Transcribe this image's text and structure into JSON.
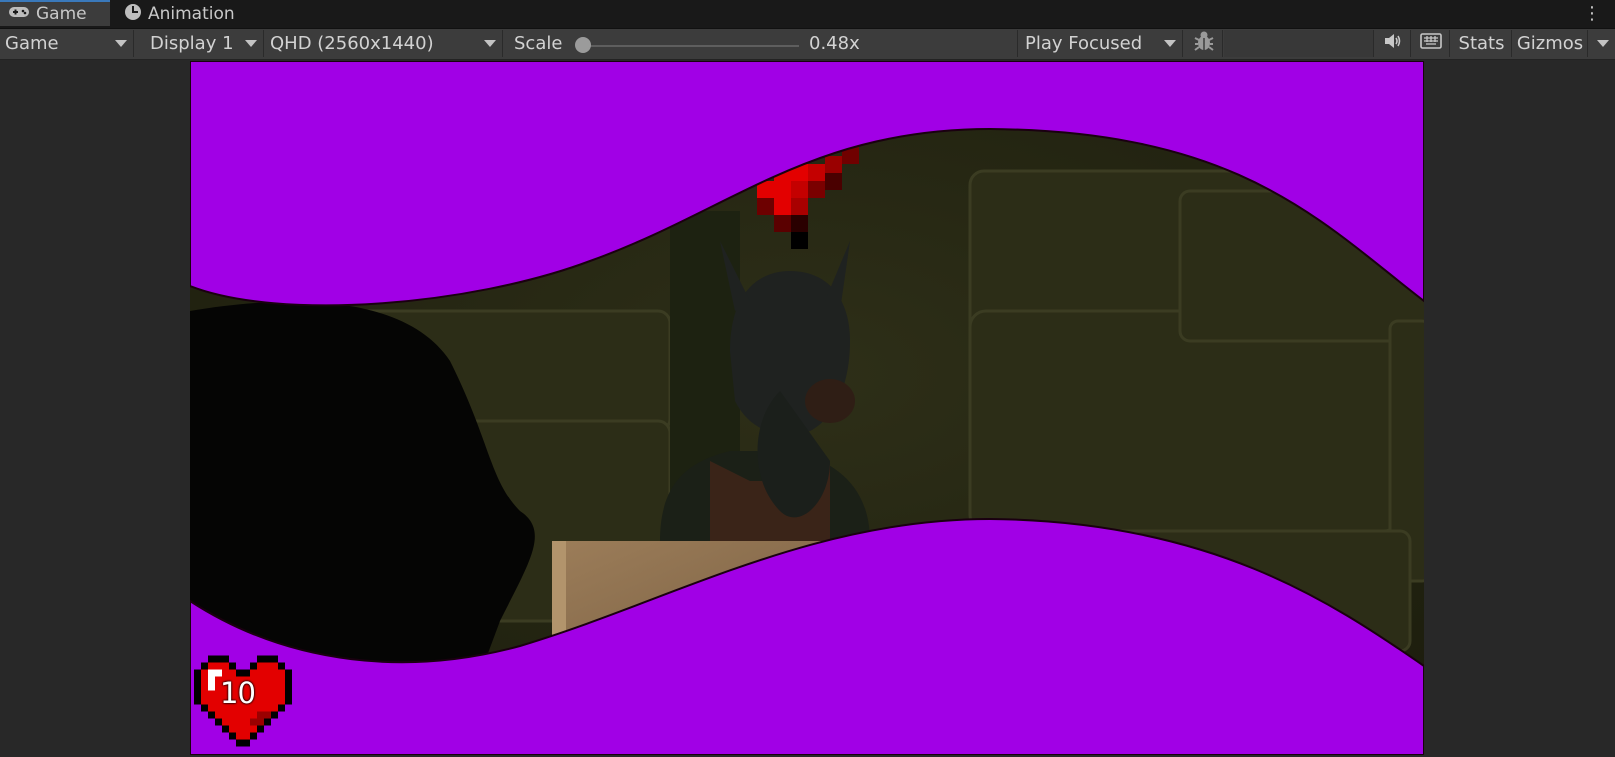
{
  "tabs": [
    {
      "label": "Game",
      "icon": "gamepad-icon",
      "active": true
    },
    {
      "label": "Animation",
      "icon": "clock-icon",
      "active": false
    }
  ],
  "toolbar": {
    "view_mode": "Game",
    "display": "Display 1",
    "resolution": "QHD (2560x1440)",
    "scale_label": "Scale",
    "scale_value": "0.48x",
    "scale_level": 0.0,
    "play_mode": "Play Focused",
    "stats_label": "Stats",
    "gizmos_label": "Gizmos",
    "icons": [
      "bug-icon",
      "audio-icon",
      "keyboard-icon"
    ]
  },
  "game": {
    "health_value": "10",
    "colors": {
      "magenta_mask": "#a100e6",
      "scene_dark": "#2b2b15",
      "heart_red": "#e30000",
      "crate": "#8f7352"
    }
  }
}
